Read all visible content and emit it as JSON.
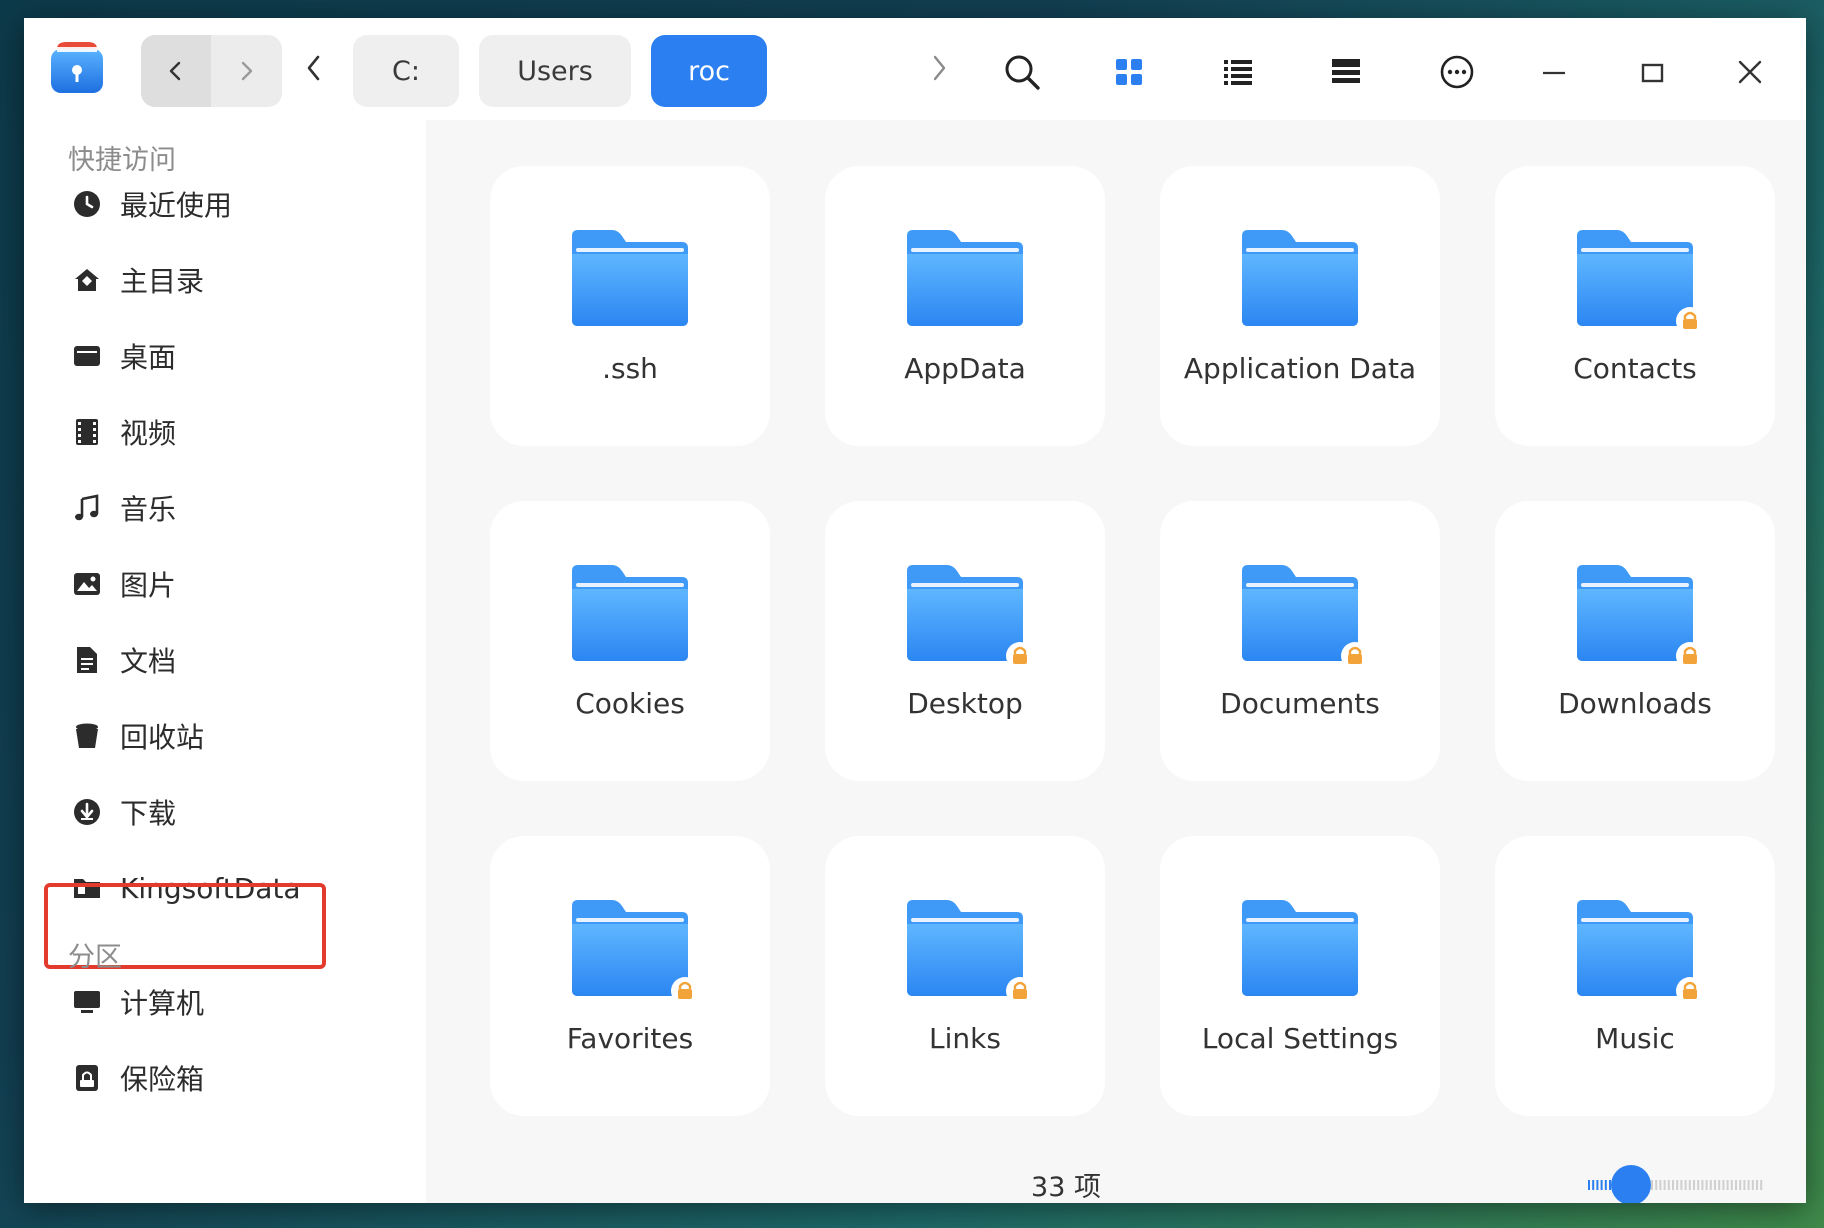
{
  "toolbar": {
    "app_icon": "file-manager-app-icon",
    "nav_back": "chevron-left-icon",
    "nav_forward": "chevron-right-icon",
    "breadcrumbs": [
      "C:",
      "Users",
      "roc"
    ],
    "active_crumb": "roc",
    "tools": [
      "search-icon",
      "icon-view-icon",
      "list-view-icon",
      "detail-view-icon",
      "more-options-icon"
    ],
    "window_controls": [
      "minimize-icon",
      "maximize-icon",
      "close-icon"
    ]
  },
  "sidebar": {
    "quick_access_title": "快捷访问",
    "items": [
      {
        "label": "最近使用",
        "icon": "clock-icon"
      },
      {
        "label": "主目录",
        "icon": "home-icon"
      },
      {
        "label": "桌面",
        "icon": "desktop-icon"
      },
      {
        "label": "视频",
        "icon": "film-icon"
      },
      {
        "label": "音乐",
        "icon": "music-icon"
      },
      {
        "label": "图片",
        "icon": "picture-icon"
      },
      {
        "label": "文档",
        "icon": "document-icon"
      },
      {
        "label": "回收站",
        "icon": "trash-icon"
      },
      {
        "label": "下载",
        "icon": "download-icon"
      },
      {
        "label": "KingsoftData",
        "icon": "folder-icon"
      }
    ],
    "partition_title": "分区",
    "partitions": [
      {
        "label": "计算机",
        "icon": "computer-icon"
      },
      {
        "label": "保险箱",
        "icon": "vault-icon"
      }
    ]
  },
  "main": {
    "folders": [
      {
        "name": ".ssh",
        "locked": false
      },
      {
        "name": "AppData",
        "locked": false
      },
      {
        "name": "Application Data",
        "locked": false
      },
      {
        "name": "Contacts",
        "locked": true
      },
      {
        "name": "Cookies",
        "locked": false
      },
      {
        "name": "Desktop",
        "locked": true
      },
      {
        "name": "Documents",
        "locked": true
      },
      {
        "name": "Downloads",
        "locked": true
      },
      {
        "name": "Favorites",
        "locked": true
      },
      {
        "name": "Links",
        "locked": true
      },
      {
        "name": "Local Settings",
        "locked": false
      },
      {
        "name": "Music",
        "locked": true
      }
    ]
  },
  "status": {
    "item_count": "33 项",
    "zoom_level": 0.25
  },
  "colors": {
    "accent": "#2b7ff0",
    "folder": "#3f9af7",
    "lock": "#f2a43a",
    "highlight": "#e23b2e"
  }
}
